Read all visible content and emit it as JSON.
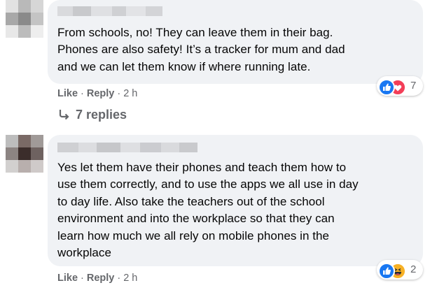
{
  "comments": [
    {
      "lines": [
        "From schools, no! They can leave them in their bag.",
        "Phones are also safety! It’s a tracker for mum and dad",
        "and we can let them know if where running late."
      ],
      "like_label": "Like",
      "reply_label": "Reply",
      "separator": "·",
      "time": "2 h",
      "reactions": [
        "like-icon",
        "love-icon"
      ],
      "reaction_count": "7",
      "replies_label": "7 replies"
    },
    {
      "lines": [
        "Yes let them have their phones and teach them how to",
        "use them correctly, and to use the apps we all use in day",
        "to day life. Also take the teachers out of the school",
        "environment and into the workplace so that they can",
        "learn how much we all rely on mobile phones in the",
        "workplace"
      ],
      "like_label": "Like",
      "reply_label": "Reply",
      "separator": "·",
      "time": "2 h",
      "reactions": [
        "like-icon",
        "haha-icon"
      ],
      "reaction_count": "2"
    }
  ],
  "colors": {
    "bubble": "#f0f2f5",
    "meta_text": "#65676b",
    "like_blue": "#1877f2",
    "love_red": "#f33e58",
    "haha_yellow": "#f7b125"
  }
}
